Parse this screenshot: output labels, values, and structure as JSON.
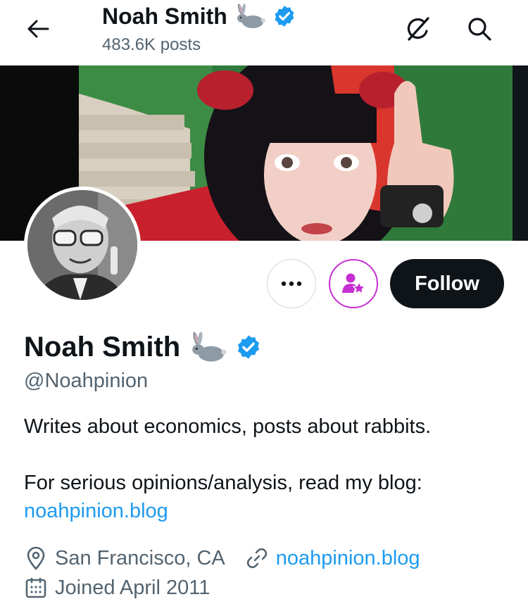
{
  "header": {
    "display_name": "Noah Smith",
    "posts_count": "483.6K posts"
  },
  "profile": {
    "display_name": "Noah Smith",
    "handle": "@Noahpinion",
    "bio_line1": "Writes about economics, posts about rabbits.",
    "bio_line2": "For serious opinions/analysis, read my blog:",
    "bio_link": "noahpinion.blog",
    "location": "San Francisco, CA",
    "website": "noahpinion.blog",
    "joined": "Joined April 2011"
  },
  "actions": {
    "more_label": "•••",
    "follow_label": "Follow"
  },
  "colors": {
    "verified": "#1d9bf0",
    "link": "#1d9bf0",
    "subscribe": "#c62fd2",
    "follow_bg": "#0f1419"
  },
  "icons": [
    "back-arrow-icon",
    "rabbit-emoji-icon",
    "verified-badge-icon",
    "grok-icon",
    "search-icon",
    "more-icon",
    "subscribe-icon",
    "location-icon",
    "link-icon",
    "calendar-icon"
  ]
}
